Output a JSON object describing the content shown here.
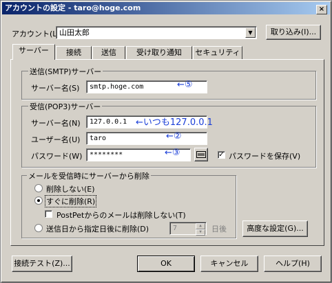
{
  "window": {
    "title": "アカウントの設定 - taro@hoge.com",
    "close": "×"
  },
  "account": {
    "label": "アカウント(L)",
    "value": "山田太郎",
    "import_button": "取り込み(I)..."
  },
  "tabs": [
    "サーバー",
    "接続",
    "送信",
    "受け取り通知",
    "セキュリティ"
  ],
  "smtp": {
    "group_title": "送信(SMTP)サーバー",
    "server_label": "サーバー名(S)",
    "server_value": "smtp.hoge.com",
    "annotation": "←⑤"
  },
  "pop3": {
    "group_title": "受信(POP3)サーバー",
    "server_label": "サーバー名(N)",
    "server_value": "127.0.0.1",
    "server_annotation": "←いつも127.0.0.1",
    "user_label": "ユーザー名(U)",
    "user_value": "taro",
    "user_annotation": "←②",
    "password_label": "パスワード(W)",
    "password_value": "********",
    "password_annotation": "←③",
    "save_password_label": "パスワードを保存(V)",
    "save_password_checked": "✓"
  },
  "delete": {
    "group_title": "メールを受信時にサーバーから削除",
    "option_none": "削除しない(E)",
    "option_now": "すぐに削除(R)",
    "postpet_label": "PostPetからのメールは削除しない(T)",
    "option_days": "送信日から指定日後に削除(D)",
    "days_value": "7",
    "days_unit": "日後",
    "advanced_button": "高度な設定(G)..."
  },
  "footer": {
    "test_button": "接続テスト(Z)...",
    "ok": "OK",
    "cancel": "キャンセル",
    "help": "ヘルプ(H)"
  }
}
